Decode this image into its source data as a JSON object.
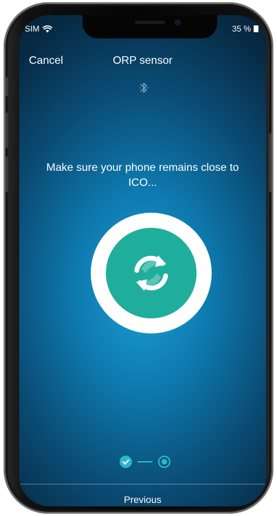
{
  "status_bar": {
    "carrier": "SIM",
    "battery": "35 %"
  },
  "nav": {
    "cancel_label": "Cancel",
    "title": "ORP sensor"
  },
  "message": "Make sure your phone remains close to ICO...",
  "footer": {
    "previous_label": "Previous"
  },
  "progress": {
    "current_step": 2,
    "total_steps": 2
  },
  "icons": {
    "bluetooth": "bluetooth-icon",
    "sync": "sync-icon",
    "step_done": "check-icon"
  },
  "colors": {
    "accent_teal": "#1fae9b",
    "step_blue": "#2ab7ca",
    "background": "#0e78ad"
  }
}
